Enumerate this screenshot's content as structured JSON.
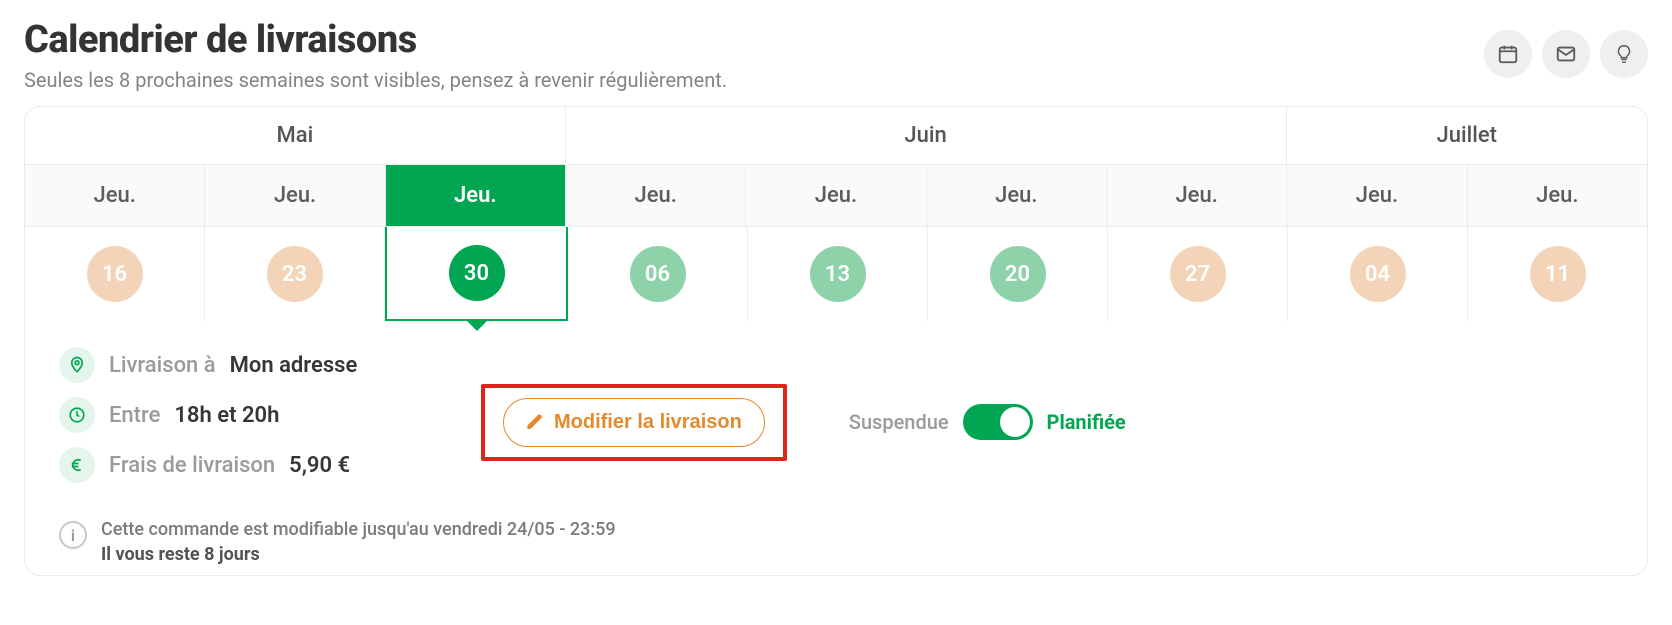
{
  "header": {
    "title": "Calendrier de livraisons",
    "subtitle": "Seules les 8 prochaines semaines sont visibles, pensez à revenir régulièrement."
  },
  "months": [
    "Mai",
    "Juin",
    "Juillet"
  ],
  "day_label": "Jeu.",
  "dates": {
    "0": "16",
    "1": "23",
    "2": "30",
    "3": "06",
    "4": "13",
    "5": "20",
    "6": "27",
    "7": "04",
    "8": "11"
  },
  "delivery": {
    "address_label": "Livraison à",
    "address_value": "Mon adresse",
    "time_label": "Entre",
    "time_value": "18h et 20h",
    "fee_label": "Frais de livraison",
    "fee_value": "5,90 €"
  },
  "actions": {
    "modify_label": "Modifier la livraison",
    "toggle_off": "Suspendue",
    "toggle_on": "Planifiée"
  },
  "deadline": {
    "line1": "Cette commande est modifiable jusqu'au vendredi 24/05 - 23:59",
    "line2": "Il vous reste 8 jours"
  }
}
